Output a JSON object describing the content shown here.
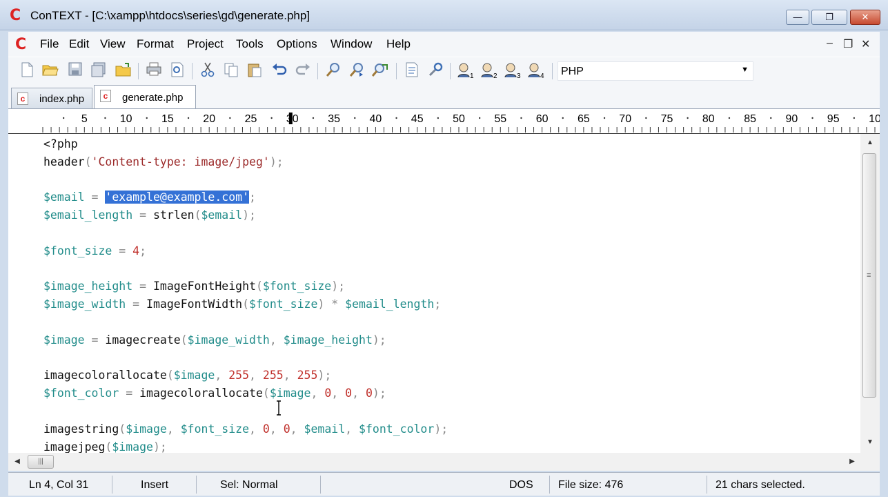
{
  "window": {
    "title": "ConTEXT - [C:\\xampp\\htdocs\\series\\gd\\generate.php]",
    "app_logo": "C",
    "controls": {
      "minimize": "—",
      "maximize": "❐",
      "close": "✕"
    }
  },
  "menubar": {
    "logo": "C",
    "items": [
      "File",
      "Edit",
      "View",
      "Format",
      "Project",
      "Tools",
      "Options",
      "Window",
      "Help"
    ],
    "doc_controls": {
      "minimize": "‒",
      "restore": "❐",
      "close": "✕"
    }
  },
  "toolbar": {
    "icons": [
      "new-file-icon",
      "open-folder-icon",
      "save-icon",
      "save-all-icon",
      "open-folder-alt-icon",
      "print-icon",
      "print-preview-icon",
      "cut-icon",
      "copy-icon",
      "paste-icon",
      "undo-icon",
      "redo-icon",
      "find-icon",
      "find-next-icon",
      "replace-icon",
      "document-icon",
      "tools-icon",
      "user-1-icon",
      "user-2-icon",
      "user-3-icon",
      "user-4-icon"
    ],
    "language": "PHP"
  },
  "tabs": [
    {
      "label": "index.php",
      "active": false
    },
    {
      "label": "generate.php",
      "active": true
    }
  ],
  "ruler": {
    "labels": [
      "5",
      "10",
      "15",
      "20",
      "25",
      "30",
      "35",
      "40",
      "45",
      "50",
      "55",
      "60",
      "65",
      "70",
      "75",
      "80",
      "85",
      "90",
      "95",
      "10"
    ]
  },
  "editor": {
    "lines": [
      [
        [
          "t-plain",
          "<?php"
        ]
      ],
      [
        [
          "t-fn",
          "header"
        ],
        [
          "t-op",
          "("
        ],
        [
          "t-str",
          "'Content-type: image/jpeg'"
        ],
        [
          "t-op",
          ");"
        ]
      ],
      [],
      [
        [
          "t-var",
          "$email"
        ],
        [
          "t-op",
          " = "
        ],
        [
          "t-sel",
          "'example@example.com'"
        ],
        [
          "t-op",
          ";"
        ]
      ],
      [
        [
          "t-var",
          "$email_length"
        ],
        [
          "t-op",
          " = "
        ],
        [
          "t-fn",
          "strlen"
        ],
        [
          "t-op",
          "("
        ],
        [
          "t-var",
          "$email"
        ],
        [
          "t-op",
          ");"
        ]
      ],
      [],
      [
        [
          "t-var",
          "$font_size"
        ],
        [
          "t-op",
          " = "
        ],
        [
          "t-num",
          "4"
        ],
        [
          "t-op",
          ";"
        ]
      ],
      [],
      [
        [
          "t-var",
          "$image_height"
        ],
        [
          "t-op",
          " = "
        ],
        [
          "t-fn",
          "ImageFontHeight"
        ],
        [
          "t-op",
          "("
        ],
        [
          "t-var",
          "$font_size"
        ],
        [
          "t-op",
          ");"
        ]
      ],
      [
        [
          "t-var",
          "$image_width"
        ],
        [
          "t-op",
          " = "
        ],
        [
          "t-fn",
          "ImageFontWidth"
        ],
        [
          "t-op",
          "("
        ],
        [
          "t-var",
          "$font_size"
        ],
        [
          "t-op",
          ") * "
        ],
        [
          "t-var",
          "$email_length"
        ],
        [
          "t-op",
          ";"
        ]
      ],
      [],
      [
        [
          "t-var",
          "$image"
        ],
        [
          "t-op",
          " = "
        ],
        [
          "t-fn",
          "imagecreate"
        ],
        [
          "t-op",
          "("
        ],
        [
          "t-var",
          "$image_width"
        ],
        [
          "t-op",
          ", "
        ],
        [
          "t-var",
          "$image_height"
        ],
        [
          "t-op",
          ");"
        ]
      ],
      [],
      [
        [
          "t-fn",
          "imagecolorallocate"
        ],
        [
          "t-op",
          "("
        ],
        [
          "t-var",
          "$image"
        ],
        [
          "t-op",
          ", "
        ],
        [
          "t-num",
          "255"
        ],
        [
          "t-op",
          ", "
        ],
        [
          "t-num",
          "255"
        ],
        [
          "t-op",
          ", "
        ],
        [
          "t-num",
          "255"
        ],
        [
          "t-op",
          ");"
        ]
      ],
      [
        [
          "t-var",
          "$font_color"
        ],
        [
          "t-op",
          " = "
        ],
        [
          "t-fn",
          "imagecolorallocate"
        ],
        [
          "t-op",
          "("
        ],
        [
          "t-var",
          "$image"
        ],
        [
          "t-op",
          ", "
        ],
        [
          "t-num",
          "0"
        ],
        [
          "t-op",
          ", "
        ],
        [
          "t-num",
          "0"
        ],
        [
          "t-op",
          ", "
        ],
        [
          "t-num",
          "0"
        ],
        [
          "t-op",
          ");"
        ]
      ],
      [],
      [
        [
          "t-fn",
          "imagestring"
        ],
        [
          "t-op",
          "("
        ],
        [
          "t-var",
          "$image"
        ],
        [
          "t-op",
          ", "
        ],
        [
          "t-var",
          "$font_size"
        ],
        [
          "t-op",
          ", "
        ],
        [
          "t-num",
          "0"
        ],
        [
          "t-op",
          ", "
        ],
        [
          "t-num",
          "0"
        ],
        [
          "t-op",
          ", "
        ],
        [
          "t-var",
          "$email"
        ],
        [
          "t-op",
          ", "
        ],
        [
          "t-var",
          "$font_color"
        ],
        [
          "t-op",
          ");"
        ]
      ],
      [
        [
          "t-fn",
          "imagejpeg"
        ],
        [
          "t-op",
          "("
        ],
        [
          "t-var",
          "$image"
        ],
        [
          "t-op",
          ");"
        ]
      ]
    ]
  },
  "statusbar": {
    "position": "Ln 4, Col 31",
    "mode": "Insert",
    "selection_mode": "Sel: Normal",
    "line_ending": "DOS",
    "file_size": "File size: 476",
    "selection_info": "21 chars selected."
  },
  "colors": {
    "variable": "#218c8a",
    "string": "#9c2b2b",
    "number": "#c0302b",
    "selection": "#3471d6",
    "close_button": "#c74a30"
  }
}
